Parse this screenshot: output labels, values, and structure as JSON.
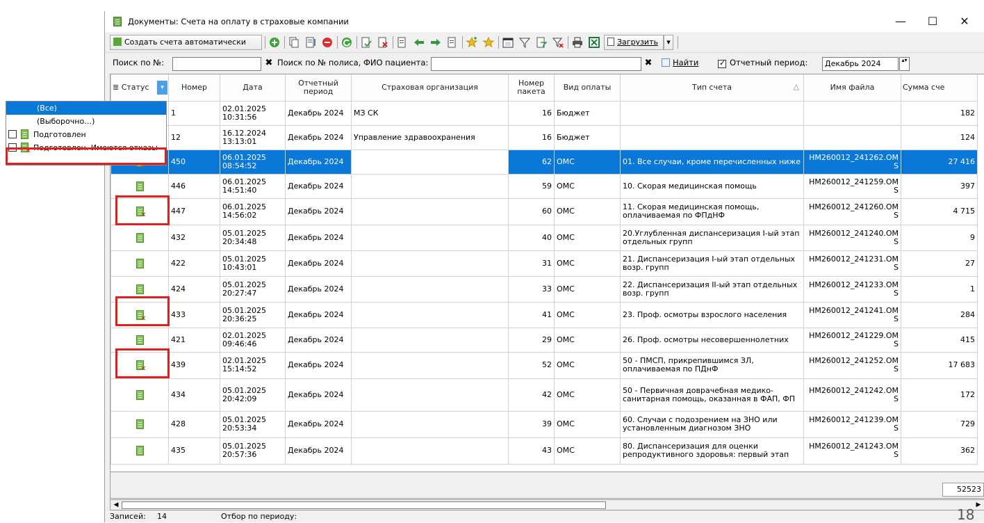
{
  "window": {
    "title": "Документы: Счета на оплату в страховые компании",
    "minimize": "—",
    "maximize": "☐",
    "close": "✕"
  },
  "toolbar": {
    "auto_create_label": "Создать счета автоматически",
    "load_label": "Загрузить",
    "load_dropdown": "▾",
    "icons": [
      "add-icon",
      "copy-icon",
      "edit-icon",
      "delete-icon",
      "refresh-icon",
      "approve-icon",
      "reject-icon",
      "export-icon",
      "arrow-left-icon",
      "arrow-right-icon",
      "import-icon",
      "star-add-icon",
      "star-icon",
      "calendar-icon",
      "filter-icon",
      "filter-edit-icon",
      "filter-clear-icon",
      "print-icon",
      "excel-icon",
      "load-icon"
    ]
  },
  "search": {
    "number_label": "Поиск по №:",
    "number_value": "",
    "policy_label": "Поиск по № полиса, ФИО пациента:",
    "policy_value": "",
    "clear_glyph": "✖",
    "find_label": "Найти",
    "period_label": "Отчетный период:",
    "period_checked": true,
    "period_value": "Декабрь  2024",
    "spin_glyph": "▴▾"
  },
  "grid": {
    "columns": [
      "Статус",
      "Номер",
      "Дата",
      "Отчетный период",
      "Страховая организация",
      "Номер пакета",
      "Вид оплаты",
      "Тип счета",
      "Имя файла",
      "Сумма сче"
    ],
    "sort_glyph": "△",
    "filter_glyph": "▾",
    "columns_glyph": "≣",
    "rows": [
      {
        "status": "",
        "num": "1",
        "date": "02.01.2025 10:31:56",
        "period": "Декабрь 2024",
        "org": "МЗ СК",
        "pkg": "16",
        "pay": "Бюджет",
        "type": "",
        "file": "",
        "sum": "182"
      },
      {
        "status": "",
        "num": "12",
        "date": "16.12.2024 13:13:01",
        "period": "Декабрь 2024",
        "org": "Управление здравоохранения",
        "pkg": "16",
        "pay": "Бюджет",
        "type": "",
        "file": "",
        "sum": "124"
      },
      {
        "status": "rejected",
        "num": "450",
        "date": "06.01.2025 08:54:52",
        "period": "Декабрь 2024",
        "org": "",
        "pkg": "62",
        "pay": "ОМС",
        "type": "01. Все случаи, кроме перечисленных ниже",
        "file": "HM260012_241262.OMS",
        "sum": "27 416",
        "selected": true
      },
      {
        "status": "ok",
        "num": "446",
        "date": "06.01.2025 14:51:40",
        "period": "Декабрь 2024",
        "org": "",
        "pkg": "59",
        "pay": "ОМС",
        "type": "10. Скорая медицинская помощь",
        "file": "HM260012_241259.OMS",
        "sum": "397"
      },
      {
        "status": "rejected",
        "num": "447",
        "date": "06.01.2025 14:56:02",
        "period": "Декабрь 2024",
        "org": "",
        "pkg": "60",
        "pay": "ОМС",
        "type": "11. Скорая медицинская помощь, оплачиваемая по ФПдНФ",
        "file": "HM260012_241260.OMS",
        "sum": "4 715"
      },
      {
        "status": "ok",
        "num": "432",
        "date": "05.01.2025 20:34:48",
        "period": "Декабрь 2024",
        "org": "",
        "pkg": "40",
        "pay": "ОМС",
        "type": "20.Углубленная диспансеризация I-ый этап отдельных групп",
        "file": "HM260012_241240.OMS",
        "sum": "9"
      },
      {
        "status": "ok",
        "num": "422",
        "date": "05.01.2025 10:43:01",
        "period": "Декабрь 2024",
        "org": "",
        "pkg": "31",
        "pay": "ОМС",
        "type": "21. Диспансеризация I-ый этап отдельных возр. групп",
        "file": "HM260012_241231.OMS",
        "sum": "27"
      },
      {
        "status": "ok",
        "num": "424",
        "date": "05.01.2025 20:27:47",
        "period": "Декабрь 2024",
        "org": "",
        "pkg": "33",
        "pay": "ОМС",
        "type": "22. Диспансеризация II-ый этап отдельных возр. групп",
        "file": "HM260012_241233.OMS",
        "sum": "1"
      },
      {
        "status": "rejected",
        "num": "433",
        "date": "05.01.2025 20:36:25",
        "period": "Декабрь 2024",
        "org": "",
        "pkg": "41",
        "pay": "ОМС",
        "type": "23. Проф. осмотры взрослого населения",
        "file": "HM260012_241241.OMS",
        "sum": "284"
      },
      {
        "status": "ok",
        "num": "421",
        "date": "02.01.2025 09:46:46",
        "period": "Декабрь 2024",
        "org": "",
        "pkg": "29",
        "pay": "ОМС",
        "type": "26. Проф. осмотры несовершеннолетних",
        "file": "HM260012_241229.OMS",
        "sum": "415"
      },
      {
        "status": "rejected",
        "num": "439",
        "date": "02.01.2025 15:14:52",
        "period": "Декабрь 2024",
        "org": "",
        "pkg": "52",
        "pay": "ОМС",
        "type": "50 - ПМСП, прикрепившимся ЗЛ, оплачиваемая по ПДнФ",
        "file": "HM260012_241252.OMS",
        "sum": "17 683"
      },
      {
        "status": "ok",
        "num": "434",
        "date": "05.01.2025 20:42:09",
        "period": "Декабрь 2024",
        "org": "",
        "pkg": "42",
        "pay": "ОМС",
        "type": "50 - Первичная доврачебная медико-санитарная помощь, оказанная в ФАП, ФП",
        "file": "HM260012_241242.OMS",
        "sum": "172"
      },
      {
        "status": "ok",
        "num": "428",
        "date": "05.01.2025 20:53:34",
        "period": "Декабрь 2024",
        "org": "",
        "pkg": "39",
        "pay": "ОМС",
        "type": "60. Случаи с подозрением на ЗНО или установленным диагнозом ЗНО",
        "file": "HM260012_241239.OMS",
        "sum": "729"
      },
      {
        "status": "ok",
        "num": "435",
        "date": "05.01.2025 20:57:36",
        "period": "Декабрь 2024",
        "org": "",
        "pkg": "43",
        "pay": "ОМС",
        "type": "80. Диспансеризация для оценки репродуктивного здоровья: первый этап",
        "file": "HM260012_241243.OMS",
        "sum": "362"
      }
    ]
  },
  "filter_popup": {
    "items": [
      {
        "label": "(Все)",
        "checkbox": false,
        "icon": "",
        "highlighted": true
      },
      {
        "label": "(Выборочно…)",
        "checkbox": false,
        "icon": ""
      },
      {
        "label": "Подготовлен",
        "checkbox": true,
        "icon": "ok"
      },
      {
        "label": "Подготовлен. Имеются отказы",
        "checkbox": true,
        "icon": "rejected"
      }
    ]
  },
  "footer": {
    "total_sum": "52523",
    "records_label": "Записей:",
    "records_count": "14",
    "period_filter_label": "Отбор по периоду:",
    "scroll_left": "◀",
    "scroll_right": "▶"
  },
  "page_number": "18",
  "colors": {
    "selection": "#0a78d7",
    "highlight_box": "#e01f1f",
    "doc_green": "#86c25a"
  }
}
